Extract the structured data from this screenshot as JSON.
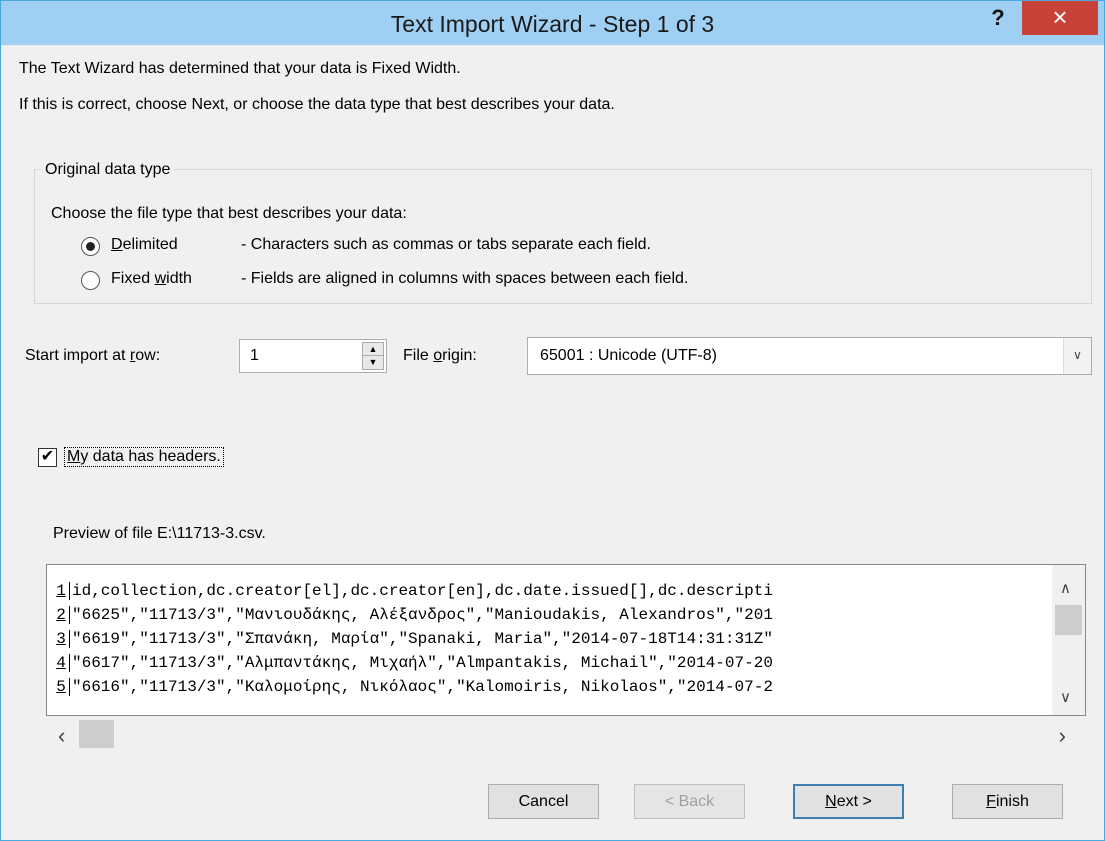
{
  "window": {
    "title": "Text Import Wizard - Step 1 of 3",
    "help_label": "?",
    "close_label": "×"
  },
  "intro": {
    "line1": "The Text Wizard has determined that your data is Fixed Width.",
    "line2": "If this is correct, choose Next, or choose the data type that best describes your data."
  },
  "original_data_type": {
    "legend": "Original data type",
    "prompt": "Choose the file type that best describes your data:",
    "options": [
      {
        "label_pre": "",
        "label_mnemonic": "D",
        "label_post": "elimited",
        "description": "- Characters such as commas or tabs separate each field.",
        "selected": true
      },
      {
        "label_pre": "Fixed ",
        "label_mnemonic": "w",
        "label_post": "idth",
        "description": "- Fields are aligned in columns with spaces between each field.",
        "selected": false
      }
    ]
  },
  "start_row": {
    "label_pre": "Start import at ",
    "label_mnemonic": "r",
    "label_post": "ow:",
    "value": "1"
  },
  "file_origin": {
    "label_pre": "File ",
    "label_mnemonic": "o",
    "label_post": "rigin:",
    "value": "65001 : Unicode (UTF-8)"
  },
  "headers_checkbox": {
    "label_mnemonic": "M",
    "label_post": "y data has headers.",
    "checked": true,
    "check_glyph": "✔"
  },
  "preview": {
    "label": "Preview of file E:\\11713-3.csv.",
    "rows": [
      {
        "num": "1",
        "text": "id,collection,dc.creator[el],dc.creator[en],dc.date.issued[],dc.descripti"
      },
      {
        "num": "2",
        "text": "\"6625\",\"11713/3\",\"Μανιουδάκης, Αλέξανδρος\",\"Manioudakis, Alexandros\",\"201"
      },
      {
        "num": "3",
        "text": "\"6619\",\"11713/3\",\"Σπανάκη, Μαρία\",\"Spanaki, Maria\",\"2014-07-18T14:31:31Z\""
      },
      {
        "num": "4",
        "text": "\"6617\",\"11713/3\",\"Αλμπαντάκης, Μιχαήλ\",\"Almpantakis, Michail\",\"2014-07-20"
      },
      {
        "num": "5",
        "text": "\"6616\",\"11713/3\",\"Καλομοίρης, Νικόλαος\",\"Kalomoiris, Nikolaos\",\"2014-07-2"
      }
    ]
  },
  "buttons": {
    "cancel": "Cancel",
    "back": "< Back",
    "next_mnemonic": "N",
    "next_post": "ext >",
    "finish_mnemonic": "F",
    "finish_post": "inish"
  },
  "icons": {
    "spin_up": "▲",
    "spin_down": "▼",
    "combo_arrow": "∨",
    "scroll_up": "∧",
    "scroll_down": "∨",
    "scroll_left": "‹",
    "scroll_right": "›"
  },
  "colors": {
    "titlebar": "#9fd0f4",
    "close_button": "#c9423a",
    "dialog_background": "#f0f0f0",
    "default_button_border": "#3c7fb1"
  }
}
